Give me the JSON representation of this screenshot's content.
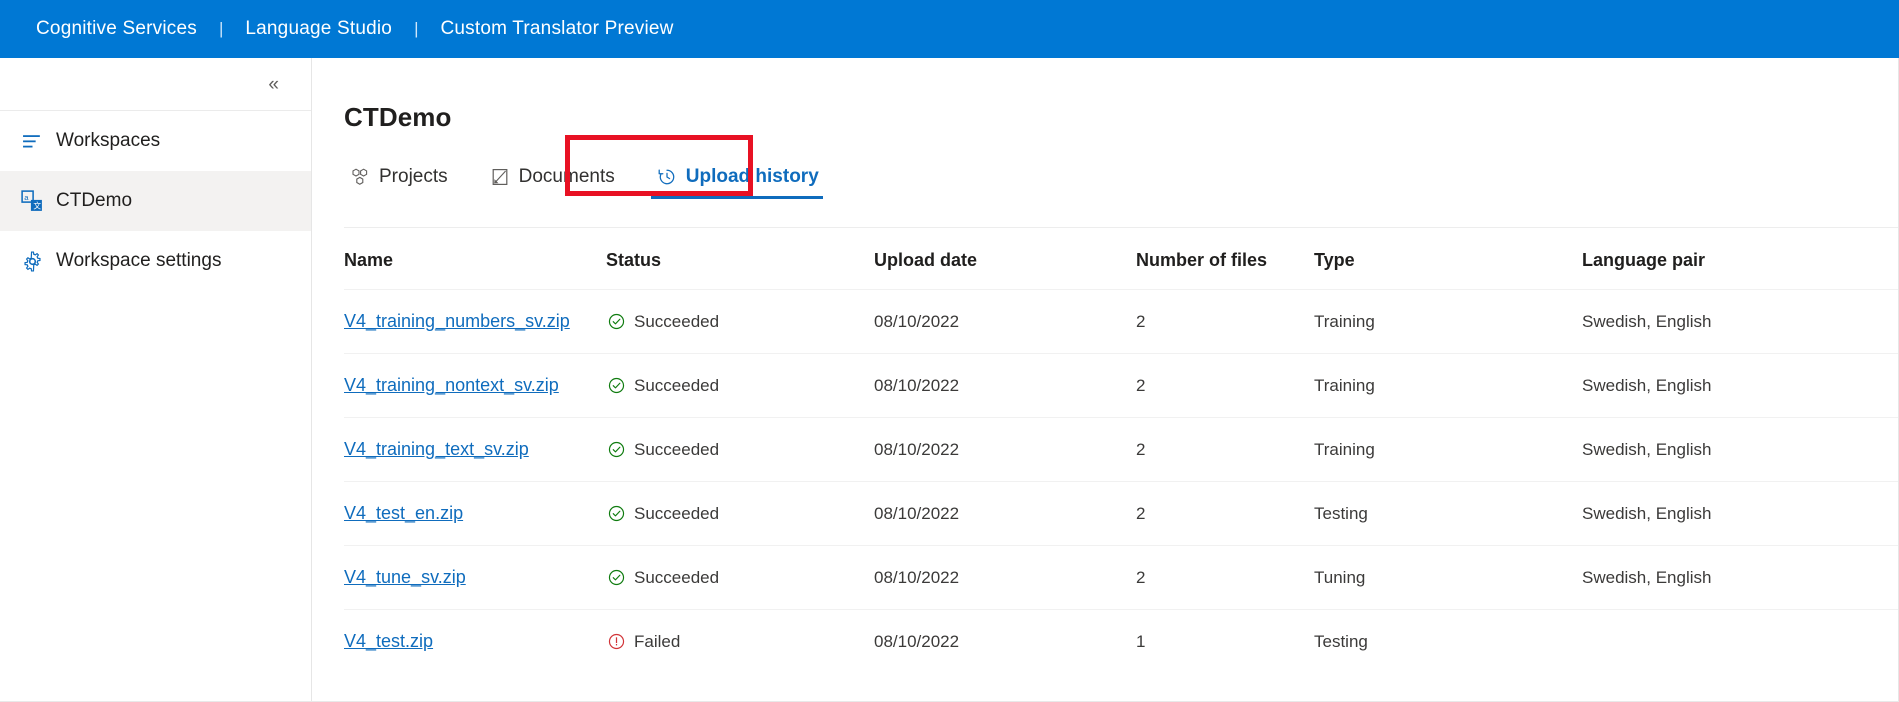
{
  "topbar": {
    "items": [
      {
        "label": "Cognitive Services"
      },
      {
        "label": "Language Studio"
      },
      {
        "label": "Custom Translator Preview"
      }
    ],
    "separator": "|",
    "background_color": "#0078d4",
    "text_color": "#ffffff"
  },
  "sidebar": {
    "collapse_icon": "chevron-double-left-icon",
    "collapse_glyph": "«",
    "items": [
      {
        "label": "Workspaces",
        "icon": "list-icon",
        "selected": false
      },
      {
        "label": "CTDemo",
        "icon": "translate-icon",
        "selected": true
      },
      {
        "label": "Workspace settings",
        "icon": "gear-icon",
        "selected": false
      }
    ]
  },
  "main": {
    "page_title": "CTDemo",
    "tabs": [
      {
        "label": "Projects",
        "icon": "projects-cubes-icon",
        "active": false
      },
      {
        "label": "Documents",
        "icon": "document-icon",
        "active": false
      },
      {
        "label": "Upload history",
        "icon": "history-clock-icon",
        "active": true
      }
    ],
    "highlight": {
      "target_tab": "Upload history",
      "color": "#e81123"
    }
  },
  "table": {
    "columns": [
      "Name",
      "Status",
      "Upload date",
      "Number of files",
      "Type",
      "Language pair"
    ],
    "rows": [
      {
        "name": "V4_training_numbers_sv.zip",
        "status": "Succeeded",
        "status_icon": "check-circle-icon",
        "upload_date": "08/10/2022",
        "number_of_files": "2",
        "type": "Training",
        "language_pair": "Swedish, English"
      },
      {
        "name": "V4_training_nontext_sv.zip",
        "status": "Succeeded",
        "status_icon": "check-circle-icon",
        "upload_date": "08/10/2022",
        "number_of_files": "2",
        "type": "Training",
        "language_pair": "Swedish, English"
      },
      {
        "name": "V4_training_text_sv.zip",
        "status": "Succeeded",
        "status_icon": "check-circle-icon",
        "upload_date": "08/10/2022",
        "number_of_files": "2",
        "type": "Training",
        "language_pair": "Swedish, English"
      },
      {
        "name": "V4_test_en.zip",
        "status": "Succeeded",
        "status_icon": "check-circle-icon",
        "upload_date": "08/10/2022",
        "number_of_files": "2",
        "type": "Testing",
        "language_pair": "Swedish, English"
      },
      {
        "name": "V4_tune_sv.zip",
        "status": "Succeeded",
        "status_icon": "check-circle-icon",
        "upload_date": "08/10/2022",
        "number_of_files": "2",
        "type": "Tuning",
        "language_pair": "Swedish, English"
      },
      {
        "name": "V4_test.zip",
        "status": "Failed",
        "status_icon": "error-circle-icon",
        "upload_date": "08/10/2022",
        "number_of_files": "1",
        "type": "Testing",
        "language_pair": ""
      }
    ]
  },
  "colors": {
    "brand_blue": "#0078d4",
    "link_blue": "#0f6cbd",
    "success_green": "#107c10",
    "error_red": "#d13438",
    "highlight_red": "#e81123",
    "selected_row_bg": "#f3f2f1"
  }
}
